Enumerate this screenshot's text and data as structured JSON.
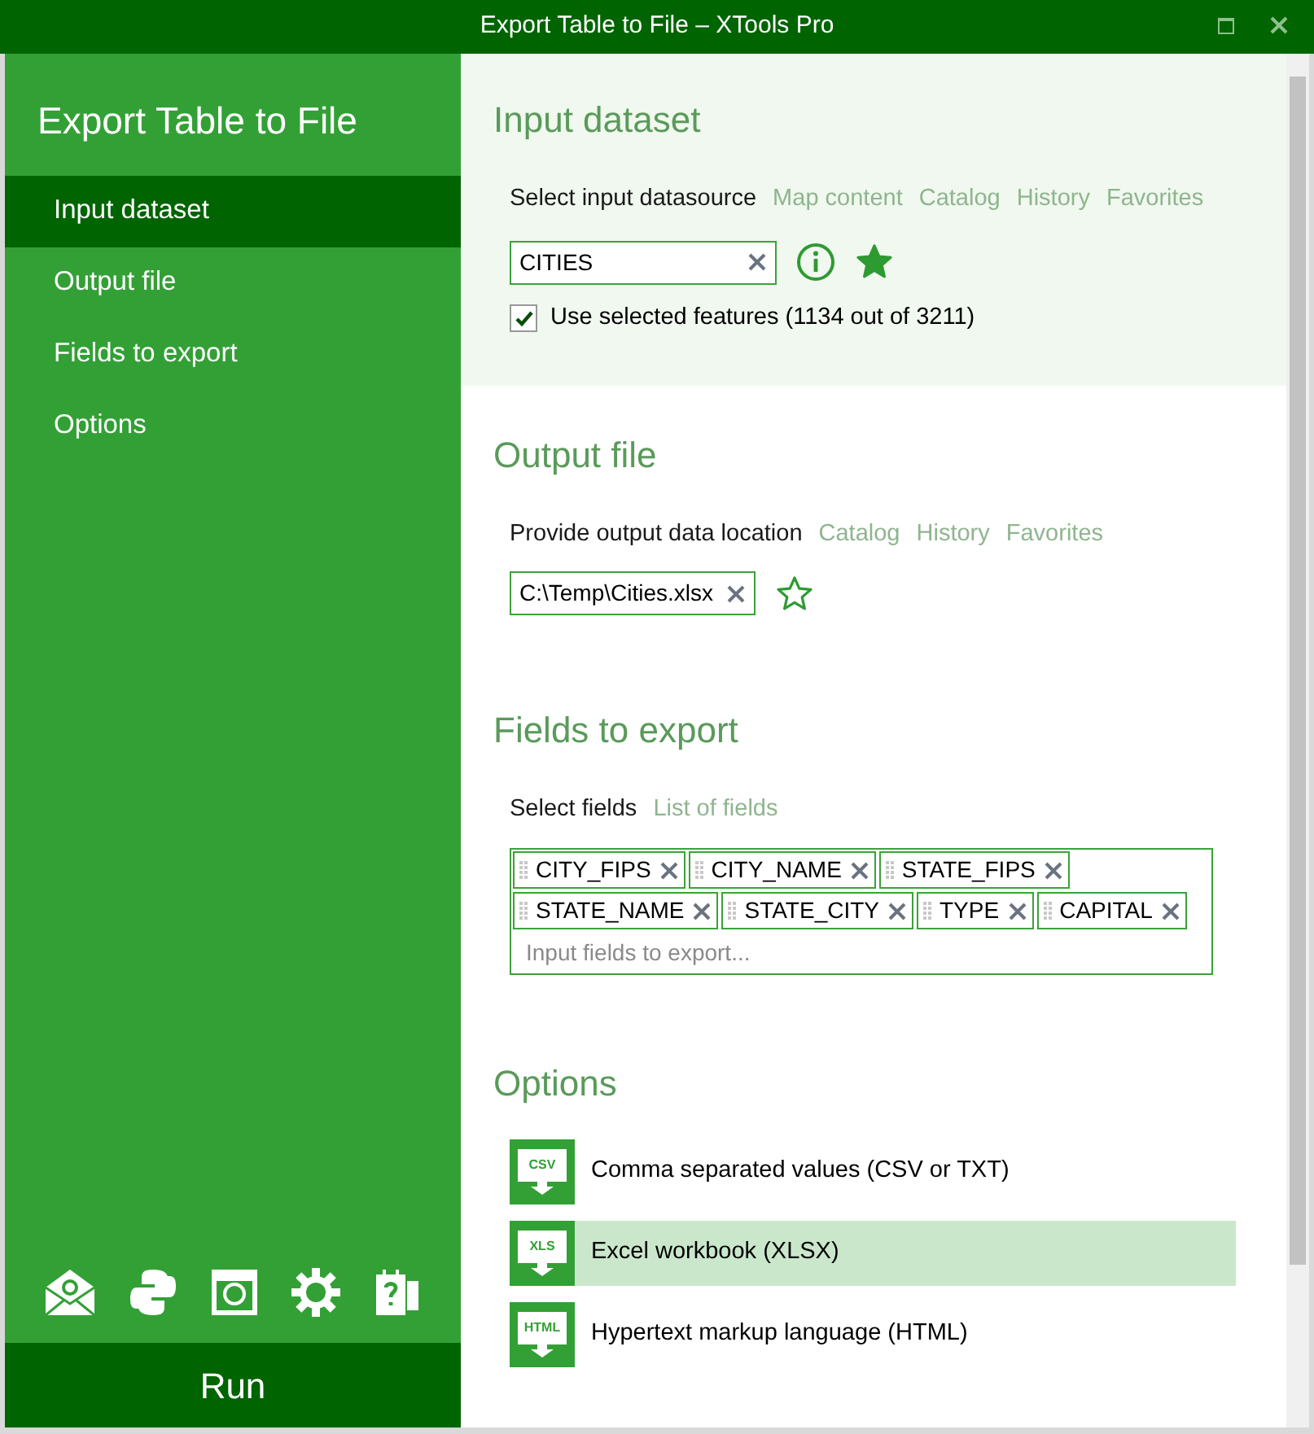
{
  "window": {
    "title": "Export Table to File – XTools Pro"
  },
  "sidebar": {
    "title": "Export Table to File",
    "items": [
      {
        "label": "Input dataset",
        "selected": true
      },
      {
        "label": "Output file",
        "selected": false
      },
      {
        "label": "Fields to export",
        "selected": false
      },
      {
        "label": "Options",
        "selected": false
      }
    ],
    "run_button": "Run"
  },
  "input_dataset": {
    "heading": "Input dataset",
    "prompt": "Select input datasource",
    "links": [
      "Map content",
      "Catalog",
      "History",
      "Favorites"
    ],
    "value": "CITIES",
    "favorite": true,
    "use_selected": {
      "label": "Use selected features (1134 out of 3211)",
      "checked": true
    }
  },
  "output_file": {
    "heading": "Output file",
    "prompt": "Provide output data location",
    "links": [
      "Catalog",
      "History",
      "Favorites"
    ],
    "value": "C:\\Temp\\Cities.xlsx",
    "favorite": false
  },
  "fields": {
    "heading": "Fields to export",
    "prompt": "Select fields",
    "links": [
      "List of fields"
    ],
    "tags": [
      "CITY_FIPS",
      "CITY_NAME",
      "STATE_FIPS",
      "STATE_NAME",
      "STATE_CITY",
      "TYPE",
      "CAPITAL"
    ],
    "placeholder": "Input fields to export..."
  },
  "options": {
    "heading": "Options",
    "items": [
      {
        "icon_text": "CSV",
        "label": "Comma separated values (CSV or TXT)",
        "selected": false
      },
      {
        "icon_text": "XLS",
        "label": "Excel workbook (XLSX)",
        "selected": true
      },
      {
        "icon_text": "HTML",
        "label": "Hypertext markup language (HTML)",
        "selected": false
      }
    ]
  }
}
